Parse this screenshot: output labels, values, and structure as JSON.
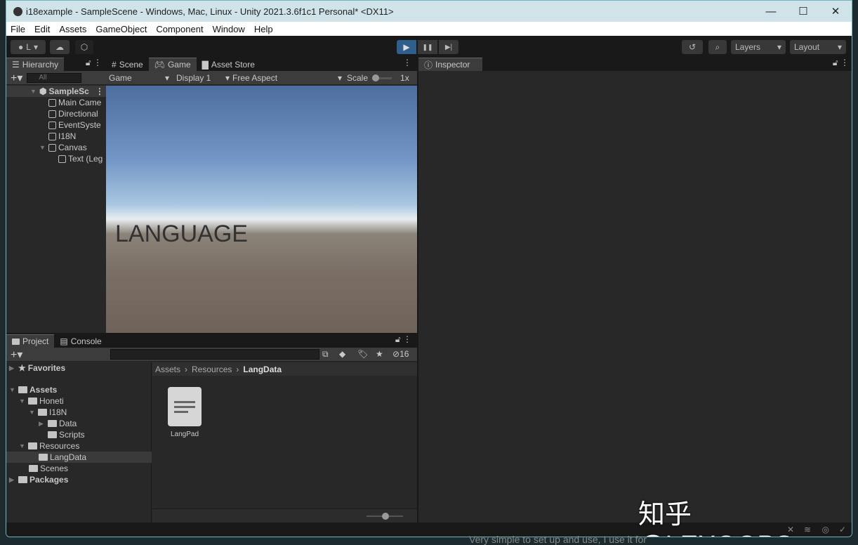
{
  "window": {
    "title": "i18example - SampleScene - Windows, Mac, Linux - Unity 2021.3.6f1c1 Personal* <DX11>",
    "minimize": "—",
    "maximize": "☐",
    "close": "✕"
  },
  "menu": [
    "File",
    "Edit",
    "Assets",
    "GameObject",
    "Component",
    "Window",
    "Help"
  ],
  "toolbar": {
    "account": "L",
    "play": "▶",
    "pause": "❚❚",
    "step": "▶|",
    "layers": "Layers",
    "layout": "Layout"
  },
  "hierarchy": {
    "tab": "Hierarchy",
    "search_placeholder": "All",
    "scene": "SampleSc",
    "items": [
      "Main Came",
      "Directional",
      "EventSyste",
      "I18N",
      "Canvas",
      "Text (Leg"
    ]
  },
  "game": {
    "tabs": [
      "Scene",
      "Game",
      "Asset Store"
    ],
    "mode": "Game",
    "display": "Display 1",
    "aspect": "Free Aspect",
    "scale_label": "Scale",
    "scale_value": "1x",
    "canvas_text": "LANGUAGE"
  },
  "inspector": {
    "tab": "Inspector"
  },
  "project": {
    "tabs": [
      "Project",
      "Console"
    ],
    "hidden_count": "16",
    "favorites": "Favorites",
    "tree": [
      {
        "label": "Assets",
        "level": 0,
        "open": true,
        "bold": true
      },
      {
        "label": "Honeti",
        "level": 1,
        "open": true
      },
      {
        "label": "I18N",
        "level": 2,
        "open": true
      },
      {
        "label": "Data",
        "level": 3,
        "collapsed": true
      },
      {
        "label": "Scripts",
        "level": 3
      },
      {
        "label": "Resources",
        "level": 1,
        "open": true
      },
      {
        "label": "LangData",
        "level": 2,
        "selected": true
      },
      {
        "label": "Scenes",
        "level": 1
      },
      {
        "label": "Packages",
        "level": 0,
        "bold": true,
        "collapsed": true
      }
    ],
    "breadcrumb": [
      "Assets",
      "Resources",
      "LangData"
    ],
    "files": [
      "LangPad"
    ]
  },
  "watermark": "知乎 @LEXOOPS",
  "outside_text": "Very simple to set up and use, I use it for"
}
